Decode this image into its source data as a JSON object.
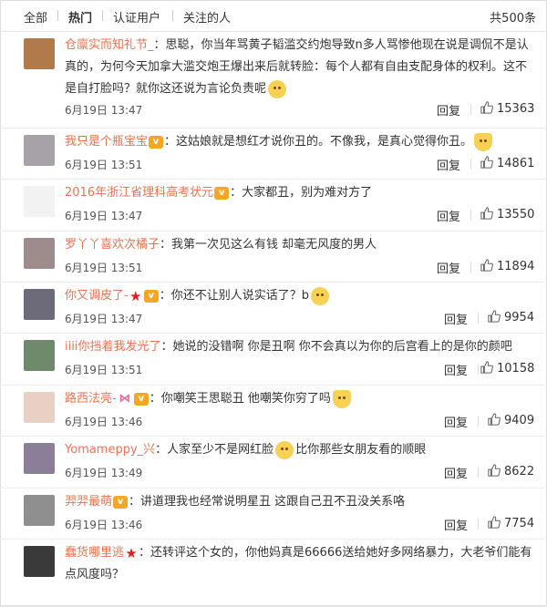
{
  "tabs": [
    {
      "label": "全部"
    },
    {
      "label": "热门"
    },
    {
      "label": "认证用户"
    },
    {
      "label": "关注的人"
    }
  ],
  "total": "共500条",
  "reply_label": "回复",
  "accent_color": "#eb7350",
  "comments": [
    {
      "user": "仓廪实而知礼节_",
      "text": "：思聪，你当年骂黄子韬滥交约炮导致n多人骂惨他现在说是调侃不是认真的，为何今天加拿大滥交炮王爆出来后就转脸：每个人都有自由支配身体的权利。这不是自打脸吗？就你这还说为言论负责呢",
      "time": "6月19日 13:47",
      "likes": "15363",
      "avatar_color": "#b07a4a",
      "badges": [],
      "emoji": true
    },
    {
      "user": "我只是个瓶宝宝",
      "text": "：这姑娘就是想红才说你丑的。不像我，是真心觉得你丑。",
      "time": "6月19日 13:51",
      "likes": "14861",
      "avatar_color": "#a7a1a8",
      "badges": [
        "vip"
      ],
      "emoji": true
    },
    {
      "user": "2016年浙江省理科高考状元",
      "text": "：大家都丑，别为难对方了",
      "time": "6月19日 13:47",
      "likes": "13550",
      "avatar_color": "#f2f2f2",
      "badges": [
        "vip"
      ],
      "emoji": false
    },
    {
      "user": "罗丫丫喜欢次橘子",
      "text": "：我第一次见这么有钱 却毫无风度的男人",
      "time": "6月19日 13:51",
      "likes": "11894",
      "avatar_color": "#9e8c8c",
      "badges": [],
      "emoji": false
    },
    {
      "user": "你又调皮了-",
      "text": "：你还不让别人说实话了？b",
      "time": "6月19日 13:47",
      "likes": "9954",
      "avatar_color": "#6d6a7a",
      "badges": [
        "star",
        "vip"
      ],
      "emoji": true
    },
    {
      "user": "iiii你挡着我发光了",
      "text": "：她说的没错啊 你是丑啊 你不会真以为你的后宫看上的是你的颜吧",
      "time": "6月19日 13:51",
      "likes": "10158",
      "avatar_color": "#6e8a6a",
      "badges": [],
      "emoji": false
    },
    {
      "user": "路西法亮-",
      "text": "：你嘲笑王思聪丑 他嘲笑你穷了吗",
      "time": "6月19日 13:46",
      "likes": "9409",
      "avatar_color": "#e8d0c4",
      "badges": [
        "bow",
        "vip"
      ],
      "emoji": true
    },
    {
      "user": "Yomameppy_兴",
      "text": "：人家至少不是网红脸",
      "text2": "比你那些女朋友看的顺眼",
      "time": "6月19日 13:49",
      "likes": "8622",
      "avatar_color": "#8a7f96",
      "badges": [],
      "emoji": true
    },
    {
      "user": "羿羿最萌",
      "text": "：讲道理我也经常说明星丑 这跟自己丑不丑没关系咯",
      "time": "6月19日 13:46",
      "likes": "7754",
      "avatar_color": "#8f8f8f",
      "badges": [
        "vip"
      ],
      "emoji": false
    },
    {
      "user": "蠢货哪里逃",
      "text": "：还转评这个女的，你他妈真是66666送给她好多网络暴力，大老爷们能有点风度吗？",
      "time": "",
      "likes": "",
      "avatar_color": "#3a3a3a",
      "badges": [
        "star"
      ],
      "emoji": false
    }
  ]
}
